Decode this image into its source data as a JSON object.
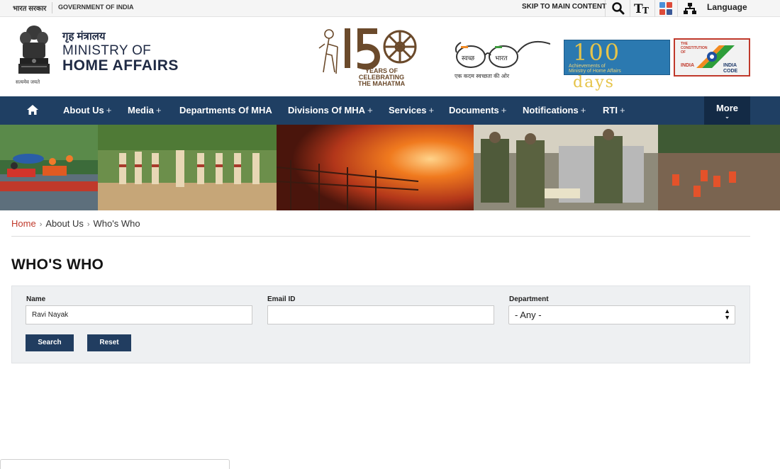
{
  "topbar": {
    "gov_hindi": "भारत सरकार",
    "gov_english": "GOVERNMENT OF INDIA",
    "skip_link": "SKIP TO MAIN CONTENT",
    "language_label": "Language",
    "icons": [
      "search-icon",
      "text-size-icon",
      "social-media-icon",
      "sitemap-icon"
    ]
  },
  "header": {
    "ministry_hindi": "गृह मंत्रालय",
    "ministry_line1": "MINISTRY OF",
    "ministry_line2": "HOME AFFAIRS",
    "emblem_caption": "सत्यमेव जयते",
    "logo_150": {
      "number": "150",
      "line1": "YEARS OF",
      "line2": "CELEBRATING",
      "line3": "THE MAHATMA"
    },
    "swachh": {
      "left": "स्वच्छ",
      "right": "भारत",
      "caption": "एक कदम स्वच्छता की ओर"
    },
    "days100": {
      "number": "100",
      "word": "days",
      "caption_line1": "Achievements of",
      "caption_line2": "Ministry of Home Affairs"
    },
    "india_code": {
      "line1": "THE",
      "line2": "CONSTITUTION",
      "line3": "OF",
      "line4": "INDIA",
      "brand1": "INDIA",
      "brand2": "CODE"
    }
  },
  "nav": {
    "items": [
      {
        "label": "About Us",
        "has_plus": "+"
      },
      {
        "label": "Media",
        "has_plus": "+"
      },
      {
        "label": "Departments Of MHA",
        "has_plus": ""
      },
      {
        "label": "Divisions Of MHA",
        "has_plus": "+"
      },
      {
        "label": "Services",
        "has_plus": "+"
      },
      {
        "label": "Documents",
        "has_plus": "+"
      },
      {
        "label": "Notifications",
        "has_plus": "+"
      },
      {
        "label": "RTI",
        "has_plus": "+"
      }
    ],
    "more_label": "More"
  },
  "breadcrumb": {
    "items": [
      "Home",
      "About Us",
      "Who's Who"
    ],
    "separator": "›"
  },
  "page": {
    "title": "WHO'S WHO"
  },
  "search_form": {
    "name_label": "Name",
    "name_value": "Ravi Nayak",
    "email_label": "Email ID",
    "email_value": "",
    "department_label": "Department",
    "department_selected": "- Any -",
    "search_button": "Search",
    "reset_button": "Reset"
  },
  "colors": {
    "nav_bg": "#1f3f63",
    "nav_more_bg": "#132a45",
    "button_bg": "#213d60",
    "link_accent": "#c0392b",
    "form_bg": "#eef0f2"
  }
}
